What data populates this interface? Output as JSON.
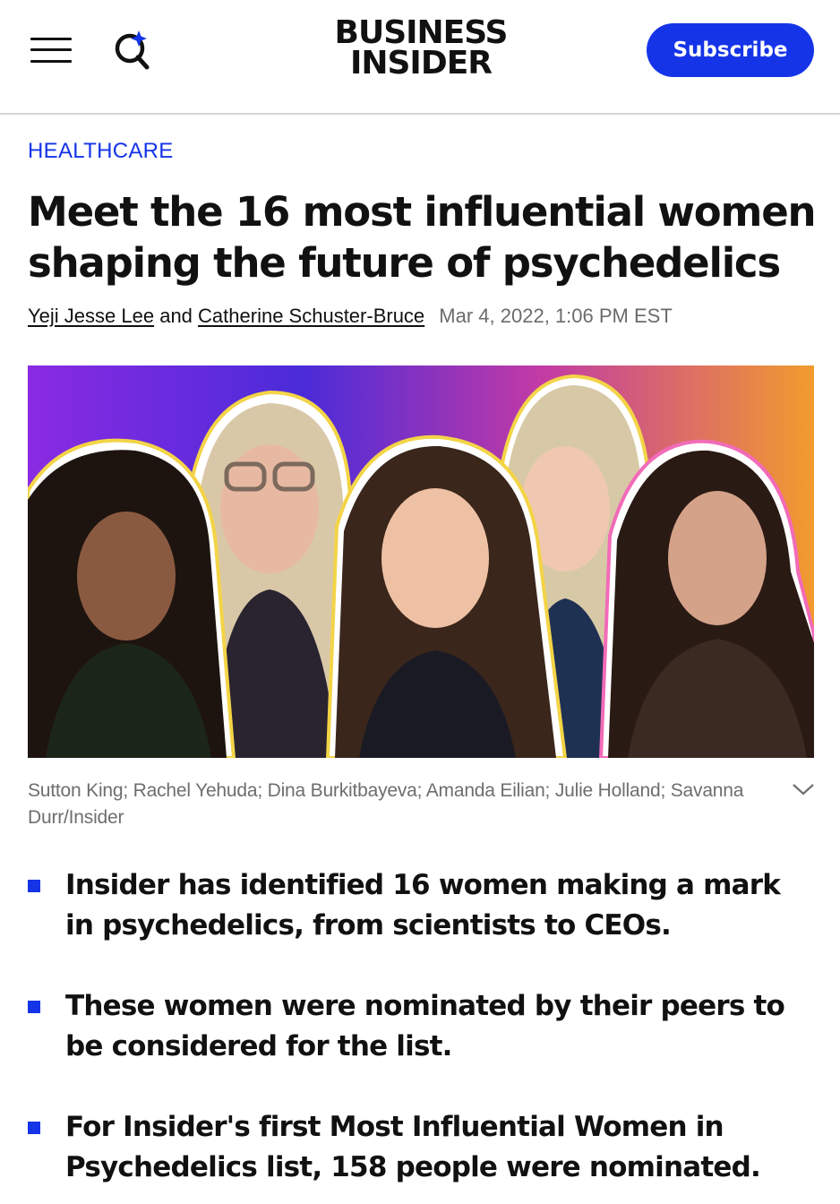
{
  "header": {
    "logo_line1": "BUSINESS",
    "logo_line2": "INSIDER",
    "subscribe_label": "Subscribe",
    "menu_icon": "hamburger-menu-icon",
    "search_icon": "search-sparkle-icon"
  },
  "article": {
    "category": "HEALTHCARE",
    "headline": "Meet the 16 most influential women shaping the future of psychedelics",
    "author1": "Yeji Jesse Lee",
    "author_joiner": "and",
    "author2": "Catherine Schuster-Bruce",
    "date": "Mar 4, 2022, 1:06 PM EST",
    "image_caption": "Sutton King; Rachel Yehuda; Dina Burkitbayeva; Amanda Eilian; Julie Holland; Savanna Durr/Insider",
    "caption_toggle_icon": "chevron-down-icon",
    "bullets": [
      "Insider has identified 16 women making a mark in psychedelics, from scientists to CEOs.",
      "These women were nominated by their peers to be considered for the list.",
      "For Insider's first Most Influential Women in Psychedelics list, 158 people were nominated."
    ]
  },
  "colors": {
    "accent": "#1534e8",
    "text": "#111111",
    "muted": "#6e6e6e"
  }
}
